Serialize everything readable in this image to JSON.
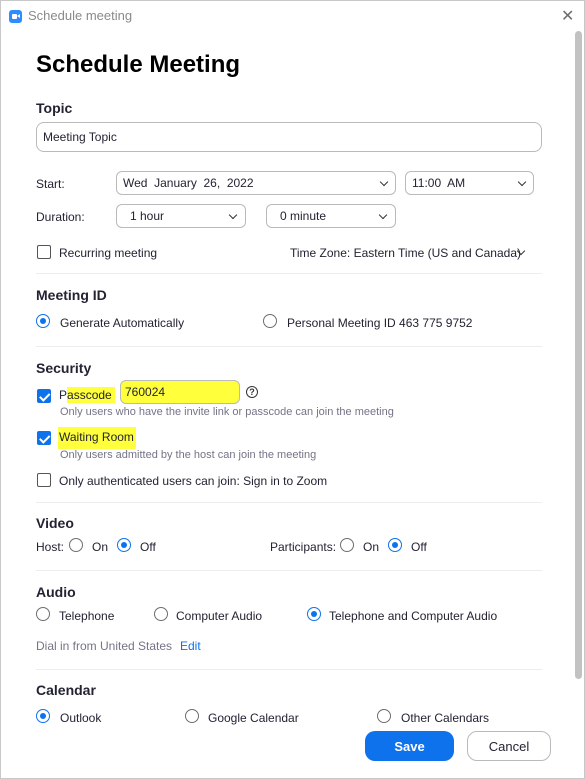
{
  "window": {
    "title": "Schedule meeting",
    "close_glyph": "✕"
  },
  "page_title": "Schedule Meeting",
  "topic": {
    "label": "Topic",
    "value": "Meeting Topic"
  },
  "start": {
    "label": "Start:",
    "date": "Wed  January  26,  2022",
    "time": "11:00  AM"
  },
  "duration": {
    "label": "Duration:",
    "hours": "1 hour",
    "minutes": "0 minute"
  },
  "recurring": {
    "label": "Recurring meeting",
    "checked": false
  },
  "timezone": {
    "label": "Time Zone: Eastern Time (US and Canada)"
  },
  "meeting_id": {
    "title": "Meeting ID",
    "options": [
      {
        "label": "Generate Automatically",
        "selected": true
      },
      {
        "label": "Personal Meeting ID 463 775 9752",
        "selected": false
      }
    ]
  },
  "security": {
    "title": "Security",
    "passcode": {
      "label_first": "P",
      "label_rest": "asscode",
      "value": "760024",
      "hint": "Only users who have the invite link or passcode can join the meeting",
      "checked": true
    },
    "waiting_room": {
      "label": "Waiting Room",
      "hint": "Only users admitted by the host can join the meeting",
      "checked": true
    },
    "auth": {
      "label": "Only authenticated users can join: Sign in to Zoom",
      "checked": false
    },
    "help_glyph": "?"
  },
  "video": {
    "title": "Video",
    "host_label": "Host:",
    "participants_label": "Participants:",
    "on_label": "On",
    "off_label": "Off",
    "host_selected": "Off",
    "participants_selected": "Off"
  },
  "audio": {
    "title": "Audio",
    "options": [
      {
        "label": "Telephone",
        "selected": false
      },
      {
        "label": "Computer Audio",
        "selected": false
      },
      {
        "label": "Telephone and Computer Audio",
        "selected": true
      }
    ],
    "dial_in": "Dial in from United States",
    "edit": "Edit"
  },
  "calendar": {
    "title": "Calendar",
    "options": [
      {
        "label": "Outlook",
        "selected": true
      },
      {
        "label": "Google Calendar",
        "selected": false
      },
      {
        "label": "Other Calendars",
        "selected": false
      }
    ]
  },
  "buttons": {
    "save": "Save",
    "cancel": "Cancel"
  },
  "colors": {
    "accent": "#0e72ed",
    "highlight": "#ffff3b",
    "text": "#232333"
  }
}
